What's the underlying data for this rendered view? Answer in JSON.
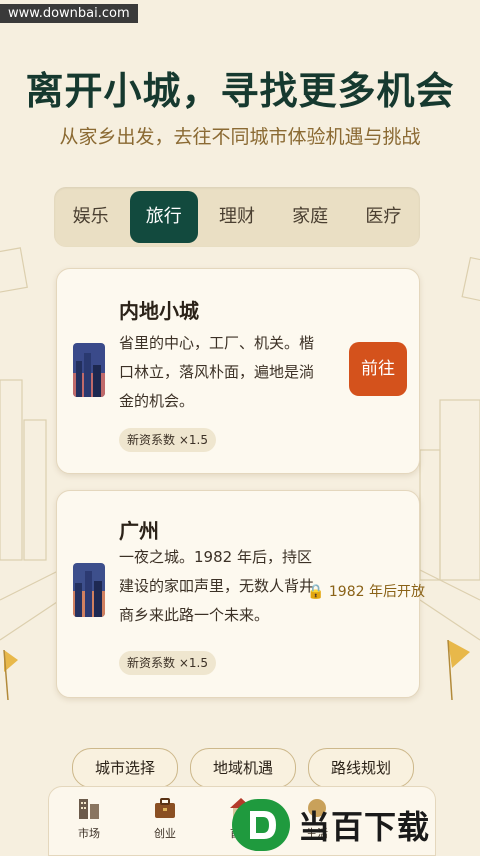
{
  "watermark": "www.downbai.com",
  "title": "离开小城，寻找更多机会",
  "subtitle": "从家乡出发，去往不同城市体验机遇与挑战",
  "tabs": [
    {
      "label": "娱乐"
    },
    {
      "label": "旅行",
      "active": true
    },
    {
      "label": "理财"
    },
    {
      "label": "家庭"
    },
    {
      "label": "医疗"
    }
  ],
  "cards": [
    {
      "title": "内地小城",
      "desc": "省里的中心，工厂、机关。楷口林立，落风朴面，遍地是淌金的机会。",
      "badge": "新资系数 ×1.5",
      "action": "前往"
    },
    {
      "title": "广州",
      "desc": "一夜之城。1982 年后，持区建设的家吅声里，无数人背井商乡来此路一个未来。",
      "badge": "新资系数 ×1.5",
      "locked": "🔒 1982 年后开放"
    }
  ],
  "chips": [
    "城市选择",
    "地域机遇",
    "路线规划"
  ],
  "nav": [
    {
      "label": "市场",
      "icon": "building-icon"
    },
    {
      "label": "创业",
      "icon": "briefcase-icon"
    },
    {
      "label": "首页",
      "icon": "home-icon"
    },
    {
      "label": "生活",
      "icon": "life-icon"
    }
  ],
  "logo_watermark": "当百下载",
  "colors": {
    "primary": "#124a3e",
    "accent": "#d4521c",
    "background": "#f6efdf"
  }
}
